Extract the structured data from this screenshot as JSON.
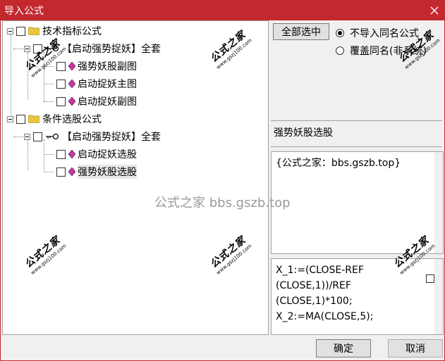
{
  "window": {
    "title": "导入公式"
  },
  "tree": {
    "nodes": [
      {
        "label": "技术指标公式"
      },
      {
        "label": "【启动强势捉妖】全套"
      },
      {
        "label": "强势妖股副图"
      },
      {
        "label": "启动捉妖主图"
      },
      {
        "label": "启动捉妖副图"
      },
      {
        "label": "条件选股公式"
      },
      {
        "label": "【启动强势捉妖】全套"
      },
      {
        "label": "启动捉妖选股"
      },
      {
        "label": "强势妖股选股"
      }
    ]
  },
  "options": {
    "select_all_label": "全部选中",
    "radio_no_import_label": "不导入同名公式",
    "radio_overwrite_label": "覆盖同名(非系统)"
  },
  "selected_formula": {
    "name": "强势妖股选股",
    "description": "{公式之家：bbs.gszb.top}",
    "code_lines": [
      "X_1:=(CLOSE-REF",
      "(CLOSE,1))/REF",
      "(CLOSE,1)*100;",
      "X_2:=MA(CLOSE,5);"
    ]
  },
  "footer": {
    "ok_label": "确定",
    "cancel_label": "取消"
  },
  "watermarks": {
    "center": "公式之家 bbs.gszb.top",
    "stamp_cn": "公式之家",
    "stamp_url": "www.gszj100.com"
  },
  "colors": {
    "titlebar": "#c4282f",
    "gem": "#c03aa0",
    "folder": "#e8c640"
  }
}
